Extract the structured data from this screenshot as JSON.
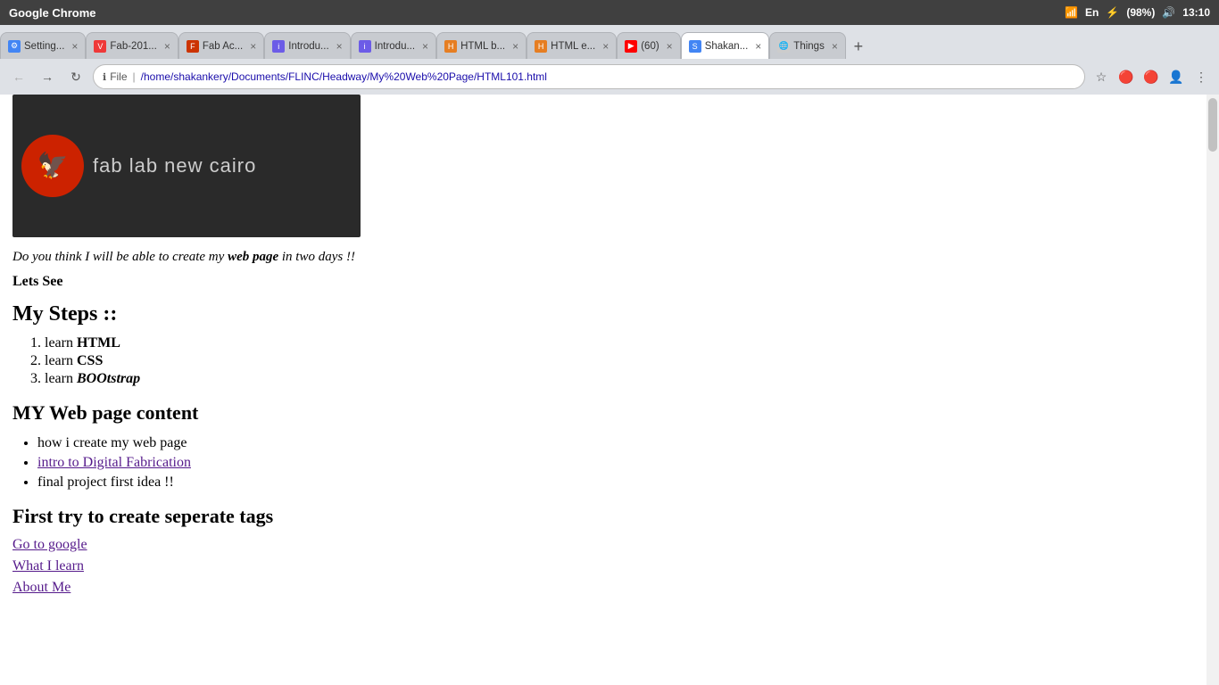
{
  "os": {
    "title": "Google Chrome",
    "titlebar_icons": [
      "wifi",
      "En",
      "bluetooth",
      "battery_98",
      "volume",
      "time_1310"
    ]
  },
  "browser": {
    "tabs": [
      {
        "id": "settings",
        "label": "Setting...",
        "favicon_type": "settings",
        "active": false
      },
      {
        "id": "fab201",
        "label": "Fab-201...",
        "favicon_type": "vivaldi",
        "active": false
      },
      {
        "id": "fab_ac",
        "label": "Fab Ac...",
        "favicon_type": "fab",
        "active": false
      },
      {
        "id": "intro1",
        "label": "Introdu...",
        "favicon_type": "intro",
        "active": false
      },
      {
        "id": "intro2",
        "label": "Introdu...",
        "favicon_type": "intro",
        "active": false
      },
      {
        "id": "html_b",
        "label": "HTML b...",
        "favicon_type": "html",
        "active": false
      },
      {
        "id": "html_e",
        "label": "HTML e...",
        "favicon_type": "html",
        "active": false
      },
      {
        "id": "youtube",
        "label": "(60)",
        "favicon_type": "youtube",
        "active": false
      },
      {
        "id": "shakan",
        "label": "Shakan...",
        "favicon_type": "sha",
        "active": true
      },
      {
        "id": "things",
        "label": "Things",
        "favicon_type": "things",
        "active": false
      }
    ],
    "address": {
      "protocol_icon": "🔒",
      "file_label": "File",
      "separator": "|",
      "url": "/home/shakankery/Documents/FLINC/Headway/My%20Web%20Page/HTML101.html"
    }
  },
  "page": {
    "header_image": {
      "logo_emoji": "🦅",
      "title": "fab lab new cairo"
    },
    "italic_line": "Do you think I will be able to create my ",
    "italic_strong": "web page",
    "italic_end": " in two days !!",
    "bold_line": "Lets See",
    "steps_heading": "My Steps ::",
    "steps": [
      {
        "text_prefix": "learn ",
        "text_strong": "HTML"
      },
      {
        "text_prefix": "learn ",
        "text_strong": "CSS"
      },
      {
        "text_prefix": "learn ",
        "text_strong_italic": "BOOtstrap"
      }
    ],
    "content_heading": "MY Web page content",
    "content_items": [
      {
        "text": "how i create my web page",
        "is_link": false
      },
      {
        "text": "intro to Digital Fabrication",
        "is_link": true
      },
      {
        "text": "final project first idea !!",
        "is_link": false
      }
    ],
    "tags_heading": "First try to create seperate tags",
    "links": [
      {
        "text": "Go to google",
        "href": "#"
      },
      {
        "text": "What I learn",
        "href": "#"
      },
      {
        "text": "About Me",
        "href": "#"
      }
    ]
  }
}
